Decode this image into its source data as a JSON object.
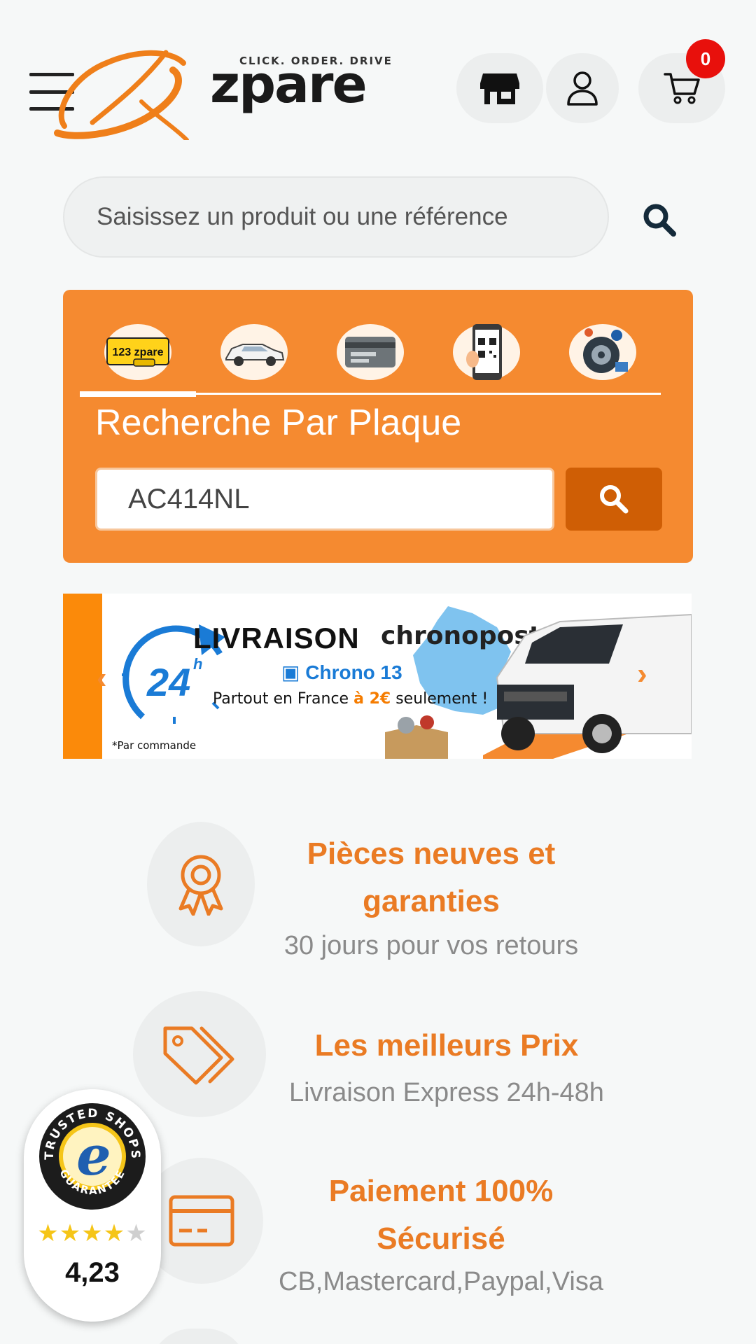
{
  "header": {
    "logo_tagline": "CLICK. ORDER. DRIVE",
    "logo_word": "zpare",
    "cart_count": "0",
    "icons": {
      "menu": "hamburger-menu-icon",
      "store": "store-icon",
      "account": "user-icon",
      "cart": "cart-icon"
    }
  },
  "search": {
    "placeholder": "Saisissez un produit ou une référence",
    "icon": "search-icon"
  },
  "plate_search": {
    "tabs": [
      {
        "name": "plate-tab",
        "icon": "license-plate-icon",
        "label": "123 zpare",
        "active": true
      },
      {
        "name": "vehicle-tab",
        "icon": "car-icon",
        "active": false
      },
      {
        "name": "card-tab",
        "icon": "registration-card-icon",
        "active": false
      },
      {
        "name": "qr-tab",
        "icon": "qr-phone-icon",
        "active": false
      },
      {
        "name": "parts-tab",
        "icon": "parts-icon",
        "active": false
      }
    ],
    "title": "Recherche Par Plaque",
    "input_value": "AC414NL"
  },
  "banner": {
    "big_number": "24",
    "hour_suffix": "h",
    "headline": "LIVRAISON",
    "brand": "chronopost",
    "service": "Chrono 13",
    "tagline_prefix": "Partout en France",
    "tagline_price": "à 2€",
    "tagline_suffix": "seulement !",
    "footnote": "*Par commande",
    "prev": "‹",
    "next": "›"
  },
  "features": [
    {
      "icon": "award-ribbon-icon",
      "title_line1": "Pièces neuves et",
      "title_line2": "garanties",
      "subtitle": "30 jours pour vos retours"
    },
    {
      "icon": "price-tags-icon",
      "title_line1": "Les meilleurs Prix",
      "subtitle": "Livraison Express 24h-48h"
    },
    {
      "icon": "credit-card-icon",
      "title_line1": "Paiement 100%",
      "title_line2": "Sécurisé",
      "subtitle": "CB,Mastercard,Paypal,Visa"
    }
  ],
  "trusted_shops": {
    "ring_text_top": "TRUSTED SHOPS",
    "ring_text_bottom": "GUARANTEE",
    "letter": "e",
    "stars_filled": "★★★★",
    "stars_empty": "★",
    "rating": "4,23"
  },
  "colors": {
    "accent": "#f58a30",
    "accent_dark": "#cf5e05",
    "feature_text": "#ea7b24",
    "badge_red": "#e8100c",
    "background": "#f6f8f8"
  }
}
